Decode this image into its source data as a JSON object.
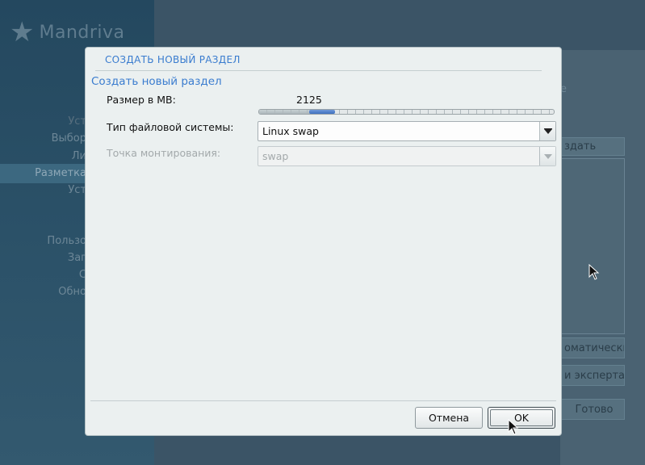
{
  "background": {
    "logo_text": "Mandriva",
    "steps": [
      "Уст",
      "Выбор",
      "Ли",
      "Разметка",
      "Уст",
      "",
      "Пользо",
      "Заг",
      "С",
      "Обно"
    ],
    "main_partial_text": "е",
    "btn_create": "здать",
    "btn_auto": "оматически",
    "btn_expert": "и эксперта",
    "btn_done": "Готово"
  },
  "dialog": {
    "title": "СОЗДАТЬ НОВЫЙ РАЗДЕЛ",
    "section_title": "Создать новый раздел",
    "size_label": "Размер в MB:",
    "size_value": "2125",
    "size_slider_fraction": 0.17,
    "fs_type_label": "Тип файловой системы:",
    "fs_type_value": "Linux swap",
    "mount_label": "Точка монтирования:",
    "mount_value": "swap",
    "cancel_label": "Отмена",
    "ok_label": "OK"
  },
  "colors": {
    "accent": "#3a7ccf",
    "slider_handle": "#3e70c0"
  }
}
